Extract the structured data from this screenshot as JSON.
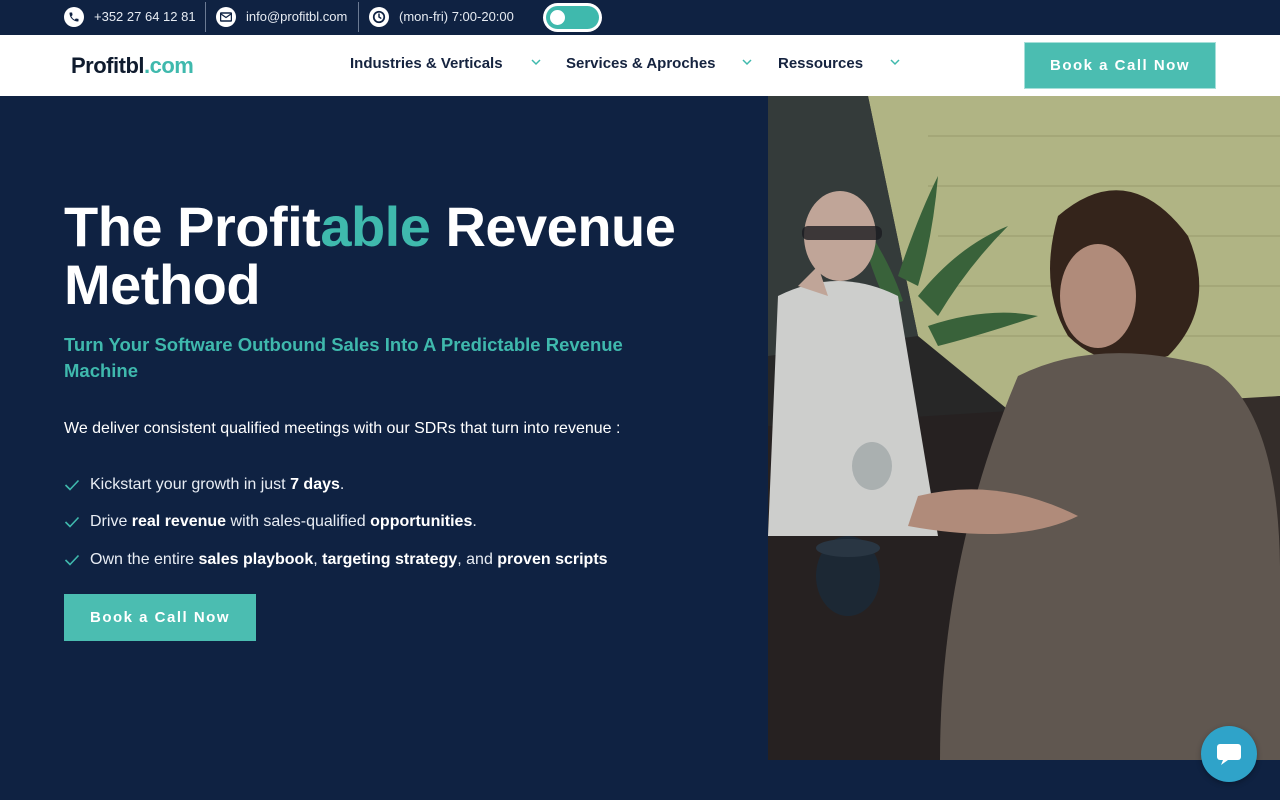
{
  "topbar": {
    "phone": "+352 27 64 12 81",
    "email": "info@profitbl.com",
    "hours": "(mon-fri) 7:00-20:00",
    "phone_icon": "phone-icon",
    "email_icon": "envelope-icon",
    "hours_icon": "clock-icon",
    "toggle": "theme-toggle"
  },
  "nav": {
    "logo_main": "Profitbl",
    "logo_domain": ".com",
    "items": [
      {
        "label": "Industries & Verticals"
      },
      {
        "label": "Services & Aproches"
      },
      {
        "label": "Ressources"
      }
    ],
    "cta": "Book a Call Now"
  },
  "hero": {
    "title_a": "The Profit",
    "title_b": "able",
    "title_c": " Revenue",
    "title_d": "Method",
    "subtitle": "Turn Your Software Outbound Sales Into A Predictable Revenue Machine",
    "intro": "We deliver consistent qualified meetings with our SDRs that turn into revenue :",
    "bullets": [
      {
        "t1": "Kickstart your growth in just ",
        "b1": "7 days",
        "t2": "."
      },
      {
        "t1": "Drive ",
        "b1": "real revenue",
        "t2": " with sales-qualified ",
        "b2": "opportunities",
        "t3": "."
      },
      {
        "t1": "Own the entire ",
        "b1": "sales playbook",
        "t2": ", ",
        "b2": "targeting strategy",
        "t3": ", and ",
        "b3": "proven scripts"
      }
    ],
    "cta": "Book a Call Now"
  },
  "colors": {
    "navy": "#0f2242",
    "teal": "#3fb9ad",
    "button": "#4bbdb1",
    "chat": "#2fa3c9"
  },
  "chat": {
    "icon": "chat-bubble-icon"
  }
}
